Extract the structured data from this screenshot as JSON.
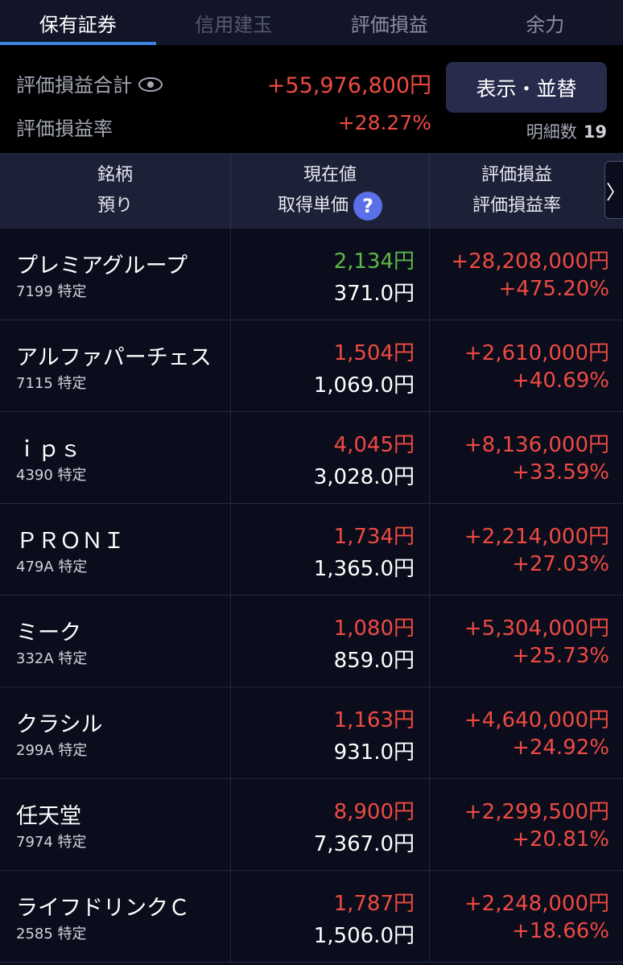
{
  "tabs": [
    {
      "label": "保有証券",
      "state": "active"
    },
    {
      "label": "信用建玉",
      "state": "dim"
    },
    {
      "label": "評価損益",
      "state": "normal"
    },
    {
      "label": "余力",
      "state": "normal"
    }
  ],
  "summary": {
    "total_label": "評価損益合計",
    "total_value": "+55,976,800円",
    "rate_label": "評価損益率",
    "rate_value": "+28.27%",
    "sort_button": "表示・並替",
    "detail_label": "明細数",
    "detail_count": "19",
    "eye_icon": "eye-icon"
  },
  "table_header": {
    "col1_line1": "銘柄",
    "col1_line2": "預り",
    "col2_line1": "現在値",
    "col2_line2": "取得単価",
    "help_icon": "?",
    "col3_line1": "評価損益",
    "col3_line2": "評価損益率",
    "more_icon": "〉"
  },
  "colors": {
    "up": "#ee4a42",
    "green": "#5cb84a",
    "accent": "#3b83e0"
  },
  "holdings": [
    {
      "name": "プレミアグループ",
      "code": "7199 特定",
      "price": "2,134円",
      "price_color": "green",
      "cost": "371.0円",
      "gain": "+28,208,000円",
      "rate": "+475.20%"
    },
    {
      "name": "アルファパーチェス",
      "code": "7115 特定",
      "price": "1,504円",
      "price_color": "red",
      "cost": "1,069.0円",
      "gain": "+2,610,000円",
      "rate": "+40.69%"
    },
    {
      "name": "ｉｐｓ",
      "code": "4390 特定",
      "price": "4,045円",
      "price_color": "red",
      "cost": "3,028.0円",
      "gain": "+8,136,000円",
      "rate": "+33.59%"
    },
    {
      "name": "ＰＲＯＮＩ",
      "code": "479A 特定",
      "price": "1,734円",
      "price_color": "red",
      "cost": "1,365.0円",
      "gain": "+2,214,000円",
      "rate": "+27.03%"
    },
    {
      "name": "ミーク",
      "code": "332A 特定",
      "price": "1,080円",
      "price_color": "red",
      "cost": "859.0円",
      "gain": "+5,304,000円",
      "rate": "+25.73%"
    },
    {
      "name": "クラシル",
      "code": "299A 特定",
      "price": "1,163円",
      "price_color": "red",
      "cost": "931.0円",
      "gain": "+4,640,000円",
      "rate": "+24.92%"
    },
    {
      "name": "任天堂",
      "code": "7974 特定",
      "price": "8,900円",
      "price_color": "red",
      "cost": "7,367.0円",
      "gain": "+2,299,500円",
      "rate": "+20.81%"
    },
    {
      "name": "ライフドリンクＣ",
      "code": "2585 特定",
      "price": "1,787円",
      "price_color": "red",
      "cost": "1,506.0円",
      "gain": "+2,248,000円",
      "rate": "+18.66%"
    }
  ]
}
